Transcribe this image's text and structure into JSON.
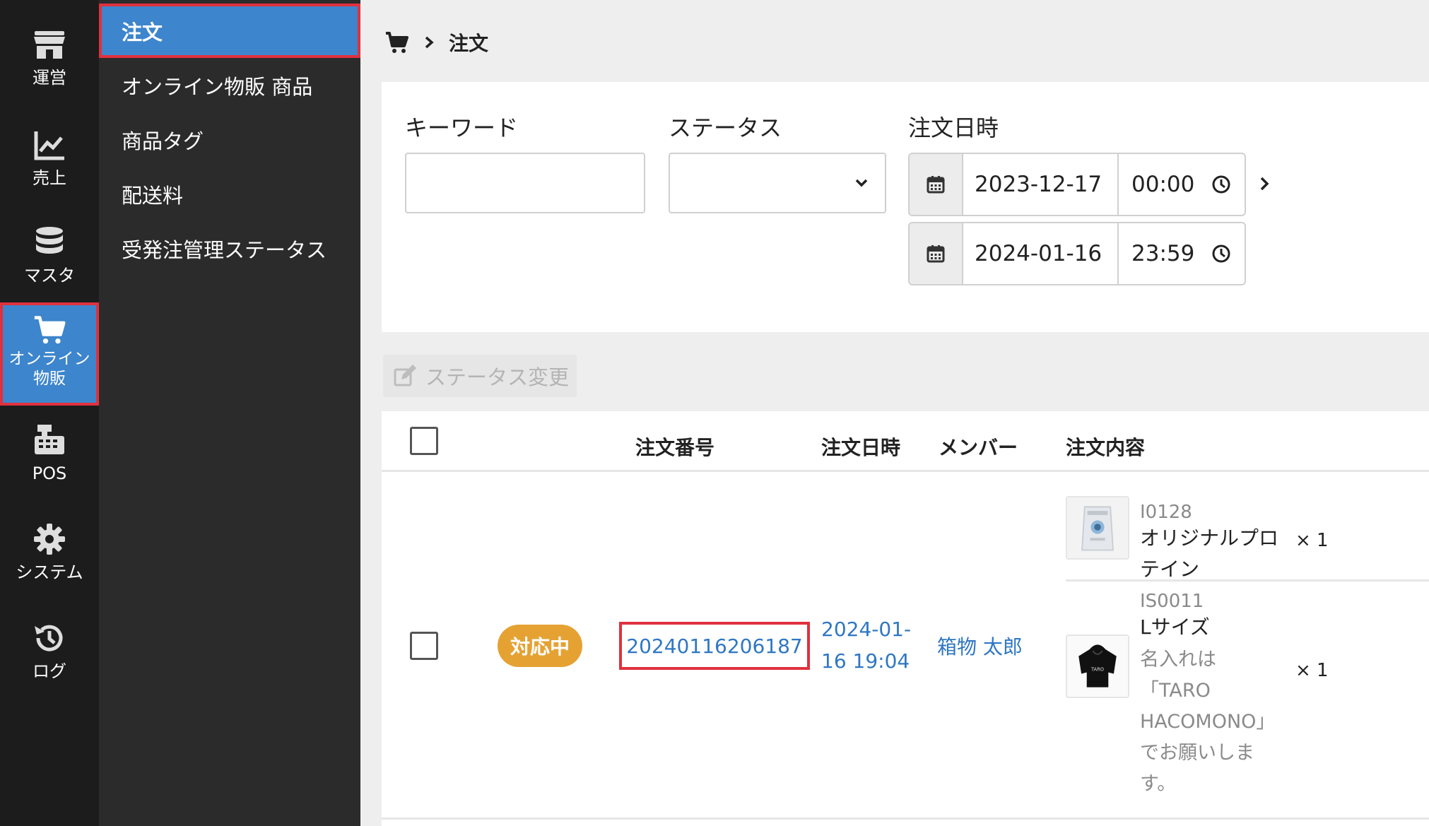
{
  "rail": {
    "items": [
      {
        "label": "運営",
        "icon": "store-icon"
      },
      {
        "label": "売上",
        "icon": "chart-line-icon"
      },
      {
        "label": "マスタ",
        "icon": "database-icon"
      },
      {
        "label": "オンライン\n物販",
        "icon": "cart-icon",
        "active": true
      },
      {
        "label": "POS",
        "icon": "cash-register-icon"
      },
      {
        "label": "システム",
        "icon": "gear-icon"
      },
      {
        "label": "ログ",
        "icon": "history-icon"
      }
    ]
  },
  "submenu": {
    "items": [
      {
        "label": "注文",
        "active": true
      },
      {
        "label": "オンライン物販 商品"
      },
      {
        "label": "商品タグ"
      },
      {
        "label": "配送料"
      },
      {
        "label": "受発注管理ステータス"
      }
    ]
  },
  "breadcrumb": {
    "icon": "cart-icon",
    "current": "注文"
  },
  "filter": {
    "keyword_label": "キーワード",
    "keyword_value": "",
    "status_label": "ステータス",
    "status_value": "",
    "date_label": "注文日時",
    "from_date": "2023-12-17",
    "from_time": "00:00",
    "to_date": "2024-01-16",
    "to_time": "23:59"
  },
  "actions": {
    "status_change_label": "ステータス変更"
  },
  "table": {
    "headers": {
      "order_no": "注文番号",
      "order_date": "注文日時",
      "member": "メンバー",
      "content": "注文内容"
    },
    "rows": [
      {
        "status": "対応中",
        "order_no": "20240116206187",
        "order_date_line1": "2024-01-",
        "order_date_line2": "16 19:04",
        "member": "箱物 太郎",
        "items": [
          {
            "code": "I0128",
            "name_line1": "オリジナルプロ",
            "name_line2": "テイン",
            "qty": "× 1"
          },
          {
            "code": "IS0011",
            "name_line1": "Lサイズ",
            "note_lines": [
              "名入れは",
              "「TARO",
              "HACOMONO」",
              "でお願いしま",
              "す。"
            ],
            "qty": "× 1"
          }
        ]
      }
    ]
  },
  "colors": {
    "accent_blue": "#3d85cc",
    "highlight_red": "#e0313e",
    "badge_orange": "#e5a233",
    "link_blue": "#2f77c3"
  }
}
